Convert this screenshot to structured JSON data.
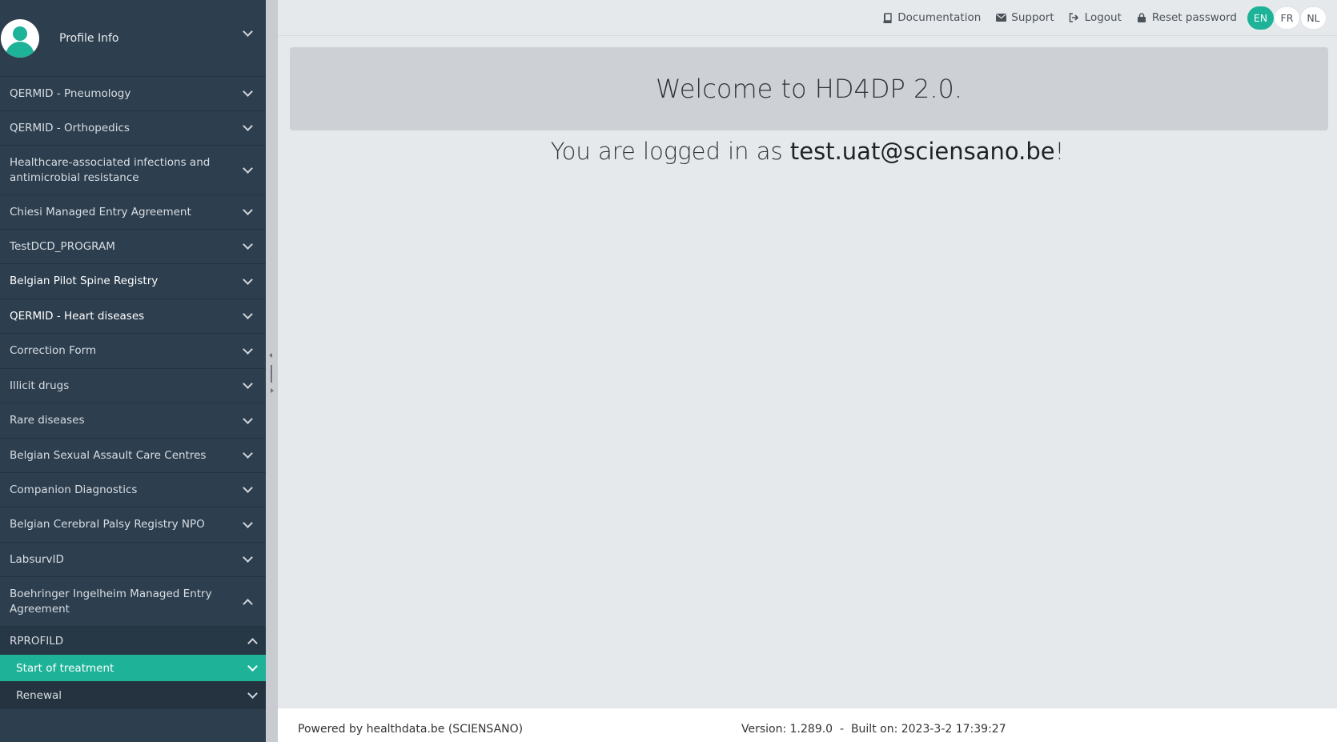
{
  "sidebar": {
    "profile_label": "Profile Info",
    "items": [
      {
        "label": "QERMID - Pneumology"
      },
      {
        "label": "QERMID - Orthopedics"
      },
      {
        "label": "Healthcare-associated infections and antimicrobial resistance"
      },
      {
        "label": "Chiesi Managed Entry Agreement"
      },
      {
        "label": "TestDCD_PROGRAM"
      },
      {
        "label": "Belgian Pilot Spine Registry"
      },
      {
        "label": "QERMID - Heart diseases"
      },
      {
        "label": "Correction Form"
      },
      {
        "label": "Illicit drugs"
      },
      {
        "label": "Rare diseases"
      },
      {
        "label": "Belgian Sexual Assault Care Centres"
      },
      {
        "label": "Companion Diagnostics"
      },
      {
        "label": "Belgian Cerebral Palsy Registry NPO"
      },
      {
        "label": "LabsurvID"
      },
      {
        "label": "Boehringer Ingelheim Managed Entry Agreement"
      }
    ],
    "sub_group": {
      "label": "RPROFILD",
      "children": [
        {
          "label": "Start of treatment"
        },
        {
          "label": "Renewal"
        }
      ]
    }
  },
  "topbar": {
    "documentation": "Documentation",
    "support": "Support",
    "logout": "Logout",
    "reset_password": "Reset password",
    "languages": [
      "EN",
      "FR",
      "NL"
    ],
    "active_language": "EN"
  },
  "main": {
    "welcome": "Welcome to HD4DP 2.0.",
    "logged_prefix": "You are logged in as",
    "user": "test.uat@sciensano.be",
    "logged_suffix": "!"
  },
  "footer": {
    "powered_by": "Powered by healthdata.be (SCIENSANO)",
    "version": "Version: 1.289.0  -  Built on: 2023-3-2 17:39:27"
  },
  "colors": {
    "sidebar_bg": "#2d3e4e",
    "accent": "#1eb399",
    "content_bg": "#e6e9ec",
    "welcome_bg": "#cdd1d5"
  }
}
